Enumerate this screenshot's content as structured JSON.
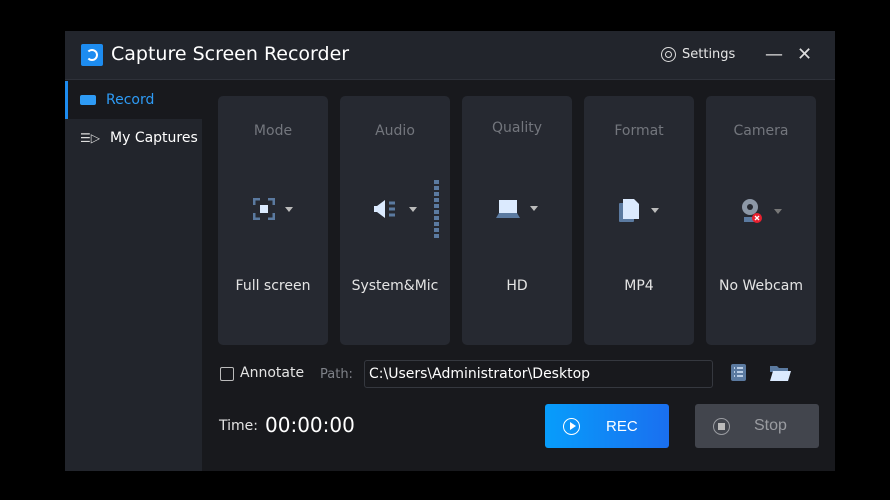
{
  "app": {
    "title": "Capture Screen Recorder",
    "settings_label": "Settings"
  },
  "sidebar": {
    "items": [
      {
        "label": "Record",
        "icon": "video-camera-icon"
      },
      {
        "label": "My Captures",
        "icon": "list-play-icon"
      }
    ]
  },
  "cards": [
    {
      "label": "Mode",
      "value": "Full screen",
      "icon": "fullscreen-icon"
    },
    {
      "label": "Audio",
      "value": "System&Mic",
      "icon": "speaker-icon"
    },
    {
      "label": "Quality",
      "value": "HD",
      "icon": "laptop-icon"
    },
    {
      "label": "Format",
      "value": "MP4",
      "icon": "file-icon"
    },
    {
      "label": "Camera",
      "value": "No Webcam",
      "icon": "webcam-off-icon"
    }
  ],
  "options": {
    "annotate_label": "Annotate",
    "annotate_checked": false,
    "path_label": "Path:",
    "path_value": "C:\\Users\\Administrator\\Desktop"
  },
  "footer": {
    "time_label": "Time:",
    "time_value": "00:00:00",
    "rec_label": "REC",
    "stop_label": "Stop"
  },
  "colors": {
    "accent": "#1d8cf0",
    "background": "#18191d",
    "card": "#262931"
  }
}
